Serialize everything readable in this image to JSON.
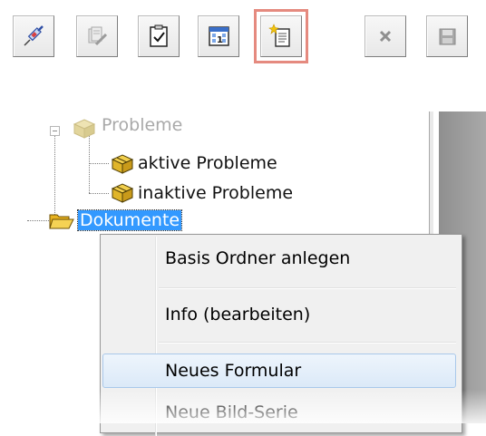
{
  "toolbar": {
    "buttons": [
      {
        "icon": "syringe-icon",
        "state": "enabled"
      },
      {
        "icon": "pages-edit-icon",
        "state": "disabled"
      },
      {
        "icon": "clipboard-check-icon",
        "state": "enabled"
      },
      {
        "icon": "calendar-icon",
        "state": "enabled"
      },
      {
        "icon": "new-form-icon",
        "state": "highlighted"
      },
      {
        "icon": "delete-x-icon",
        "state": "disabled"
      },
      {
        "icon": "save-disk-icon",
        "state": "disabled"
      }
    ],
    "highlight_color": "#e58a7f"
  },
  "tree": {
    "probleme_label": "Probleme",
    "aktive_label": "aktive Probleme",
    "inaktive_label": "inaktive Probleme",
    "dokumente_label": "Dokumente"
  },
  "context_menu": {
    "items": [
      {
        "label": "Basis Ordner anlegen"
      },
      {
        "label": "Info (bearbeiten)"
      },
      {
        "label": "Neues Formular"
      },
      {
        "label": "Neue Bild-Serie"
      }
    ]
  },
  "colors": {
    "selection": "#3399ff",
    "menu_hover_border": "#a9c8ea"
  }
}
